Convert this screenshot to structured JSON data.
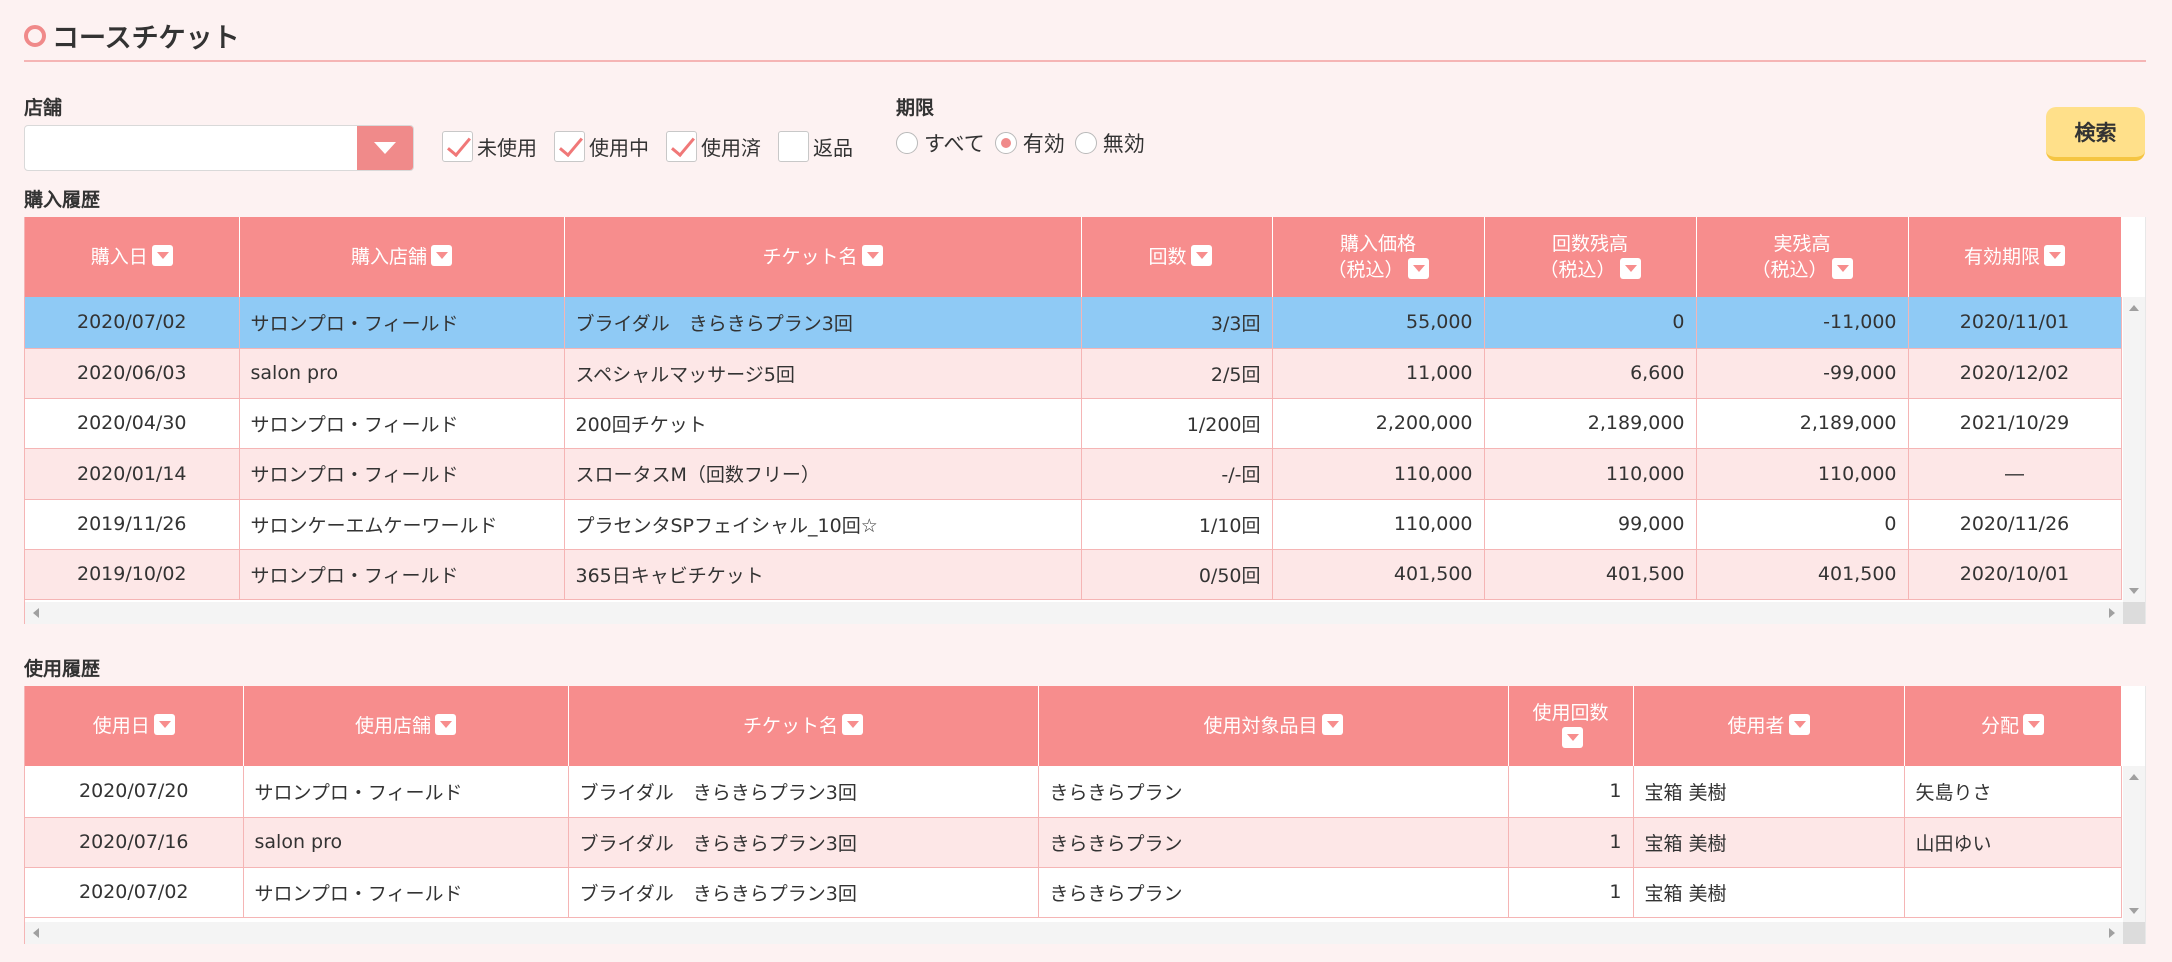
{
  "page_title": "コースチケット",
  "filters": {
    "store_label": "店舗",
    "store_value": "",
    "status_checks": [
      {
        "label": "未使用",
        "checked": true
      },
      {
        "label": "使用中",
        "checked": true
      },
      {
        "label": "使用済",
        "checked": true
      },
      {
        "label": "返品",
        "checked": false
      }
    ],
    "period_label": "期限",
    "period_options": [
      {
        "label": "すべて",
        "selected": false
      },
      {
        "label": "有効",
        "selected": true
      },
      {
        "label": "無効",
        "selected": false
      }
    ],
    "search_label": "検索"
  },
  "purchase": {
    "section_label": "購入履歴",
    "headers": [
      "購入日",
      "購入店舗",
      "チケット名",
      "回数",
      "購入価格",
      "（税込）",
      "回数残高",
      "（税込）",
      "実残高",
      "（税込）",
      "有効期限"
    ],
    "rows": [
      {
        "date": "2020/07/02",
        "store": "サロンプロ・フィールド",
        "ticket": "ブライダル　きらきらプラン3回",
        "count": "3/3回",
        "price": "55,000",
        "count_balance": "0",
        "actual_balance": "-11,000",
        "expiry": "2020/11/01"
      },
      {
        "date": "2020/06/03",
        "store": "salon pro",
        "ticket": "スペシャルマッサージ5回",
        "count": "2/5回",
        "price": "11,000",
        "count_balance": "6,600",
        "actual_balance": "-99,000",
        "expiry": "2020/12/02"
      },
      {
        "date": "2020/04/30",
        "store": "サロンプロ・フィールド",
        "ticket": "200回チケット",
        "count": "1/200回",
        "price": "2,200,000",
        "count_balance": "2,189,000",
        "actual_balance": "2,189,000",
        "expiry": "2021/10/29"
      },
      {
        "date": "2020/01/14",
        "store": "サロンプロ・フィールド",
        "ticket": "スロータスM（回数フリー）",
        "count": "-/-回",
        "price": "110,000",
        "count_balance": "110,000",
        "actual_balance": "110,000",
        "expiry": "―"
      },
      {
        "date": "2019/11/26",
        "store": "サロンケーエムケーワールド",
        "ticket": "プラセンタSPフェイシャル_10回☆",
        "count": "1/10回",
        "price": "110,000",
        "count_balance": "99,000",
        "actual_balance": "0",
        "expiry": "2020/11/26"
      },
      {
        "date": "2019/10/02",
        "store": "サロンプロ・フィールド",
        "ticket": "365日キャビチケット",
        "count": "0/50回",
        "price": "401,500",
        "count_balance": "401,500",
        "actual_balance": "401,500",
        "expiry": "2020/10/01"
      }
    ]
  },
  "usage": {
    "section_label": "使用履歴",
    "headers": [
      "使用日",
      "使用店舗",
      "チケット名",
      "使用対象品目",
      "使用回数",
      "使用者",
      "分配"
    ],
    "rows": [
      {
        "date": "2020/07/20",
        "store": "サロンプロ・フィールド",
        "ticket": "ブライダル　きらきらプラン3回",
        "item": "きらきらプラン",
        "count": "1",
        "user": "宝箱 美樹",
        "share": "矢島りさ"
      },
      {
        "date": "2020/07/16",
        "store": "salon pro",
        "ticket": "ブライダル　きらきらプラン3回",
        "item": "きらきらプラン",
        "count": "1",
        "user": "宝箱 美樹",
        "share": "山田ゆい"
      },
      {
        "date": "2020/07/02",
        "store": "サロンプロ・フィールド",
        "ticket": "ブライダル　きらきらプラン3回",
        "item": "きらきらプラン",
        "count": "1",
        "user": "宝箱 美樹",
        "share": ""
      }
    ]
  },
  "colors": {
    "accent": "#f78d8d",
    "selected_row": "#8fcaf5",
    "alt_row": "#fde7e7",
    "search_button": "#ffe08a"
  }
}
